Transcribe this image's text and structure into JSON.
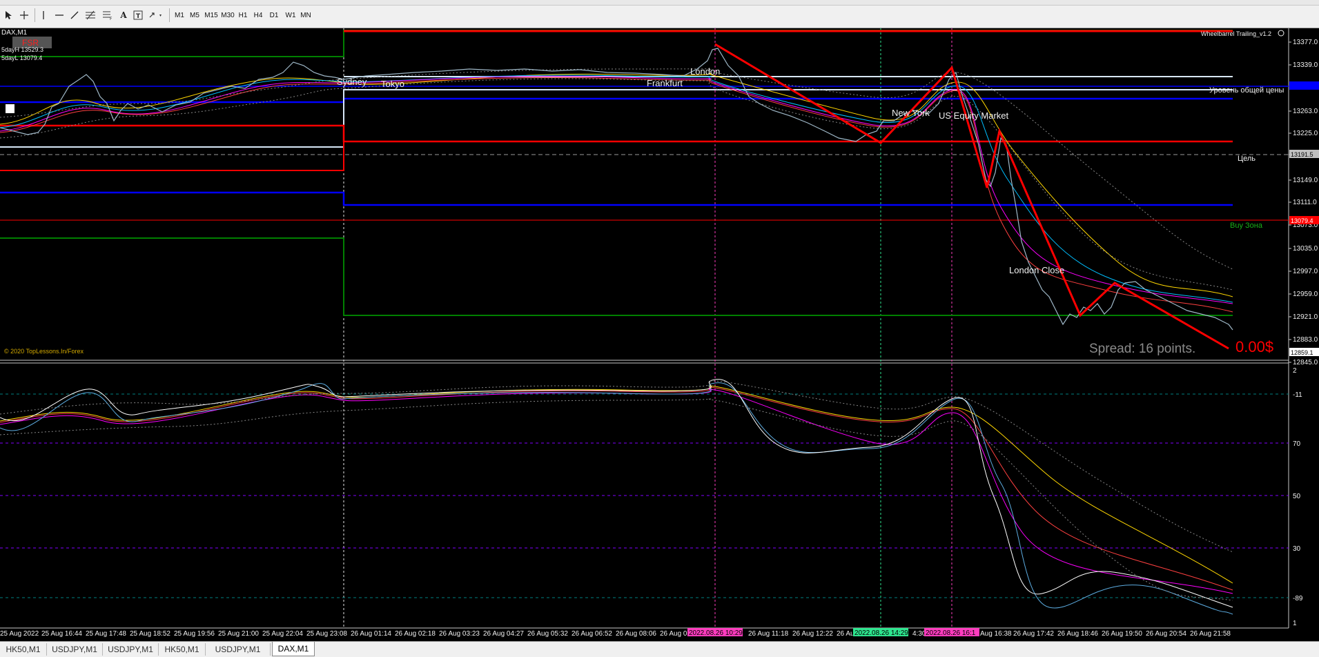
{
  "toolbar": {
    "timeframes": [
      "M1",
      "M5",
      "M15",
      "M30",
      "H1",
      "H4",
      "D1",
      "W1",
      "MN"
    ]
  },
  "chart": {
    "symbol_title": "DAX,M1",
    "fsr_label": "FSR",
    "day_high": "5dayH 13529.3",
    "day_low": "5dayL 13079.4",
    "indicator_name": "Wheelbarrel Trailing_v1.2",
    "copyright": "© 2020 TopLessons.In/Forex",
    "spread_text": "Spread: 16 points.",
    "profit_text": "0.00$",
    "sessions": {
      "sydney": "Sydney",
      "tokyo": "Tokyo",
      "frankfurt": "Frankfurt",
      "london": "London",
      "new_york": "New York",
      "us_equity": "US Equity Market",
      "london_close": "London Close"
    },
    "level_labels": {
      "price_level": "Уровень общей цены",
      "target": "Цель",
      "buy_zone": "Buy Зона"
    },
    "price_ticks": [
      "13377.0",
      "13339.0",
      "13263.0",
      "13225.0",
      "13187.0",
      "13149.0",
      "13111.0",
      "13073.0",
      "13035.0",
      "12997.0",
      "12959.0",
      "12921.0",
      "12883.0",
      "12845.0"
    ],
    "price_boxes": {
      "target": "13191.5",
      "red_level": "13079.4",
      "current": "12859.1"
    },
    "osc_ticks": [
      "2",
      "-11",
      "70",
      "50",
      "30",
      "-89",
      "1"
    ],
    "time_labels": [
      "25 Aug 2022",
      "25 Aug 16:44",
      "25 Aug 17:48",
      "25 Aug 18:52",
      "25 Aug 19:56",
      "25 Aug 21:00",
      "25 Aug 22:04",
      "25 Aug 23:08",
      "26 Aug 01:14",
      "26 Aug 02:18",
      "26 Aug 03:23",
      "26 Aug 04:27",
      "26 Aug 05:32",
      "26 Aug 06:52",
      "26 Aug 08:06",
      "26 Aug 0",
      "26 Aug 11:18",
      "26 Aug 12:22",
      "26 Au",
      "4:30",
      "Aug 16:38",
      "26 Aug 17:42",
      "26 Aug 18:46",
      "26 Aug 19:50",
      "26 Aug 20:54",
      "26 Aug 21:58"
    ],
    "time_markers": [
      {
        "text": "2022.08.26 10:29",
        "color": "#ff3cbf"
      },
      {
        "text": "2022.08.26 14:29",
        "color": "#2ee68f"
      },
      {
        "text": "2022.08.26 16:1",
        "color": "#ff3cbf"
      }
    ],
    "colors": {
      "red_line": "#ff0000",
      "blue_line": "#0000ff",
      "green_line": "#008000",
      "white_line": "#d8e8f8",
      "price_series": "#9fb8c8"
    }
  },
  "tabs": [
    "HK50,M1",
    "USDJPY,M1",
    "USDJPY,M1",
    "HK50,M1",
    "USDJPY,M1",
    "DAX,M1"
  ],
  "active_tab": "DAX,M1"
}
